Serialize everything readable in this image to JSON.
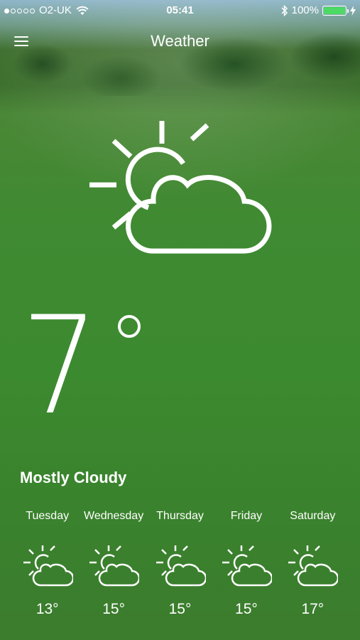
{
  "status_bar": {
    "carrier": "O2-UK",
    "time": "05:41",
    "battery": "100%",
    "signal_bars_filled": 1,
    "signal_bars_total": 5
  },
  "nav": {
    "title": "Weather",
    "menu_icon": "hamburger-menu-icon"
  },
  "current": {
    "icon": "partly-cloudy-icon",
    "temperature": "7",
    "degree_symbol": "°",
    "condition": "Mostly Cloudy"
  },
  "forecast": [
    {
      "day": "Tuesday",
      "icon": "partly-cloudy-icon",
      "temp": "13°"
    },
    {
      "day": "Wednesday",
      "icon": "partly-cloudy-icon",
      "temp": "15°"
    },
    {
      "day": "Thursday",
      "icon": "partly-cloudy-icon",
      "temp": "15°"
    },
    {
      "day": "Friday",
      "icon": "partly-cloudy-icon",
      "temp": "15°"
    },
    {
      "day": "Saturday",
      "icon": "partly-cloudy-icon",
      "temp": "17°"
    }
  ],
  "colors": {
    "battery_fill": "#4cd964",
    "text": "#ffffff"
  }
}
